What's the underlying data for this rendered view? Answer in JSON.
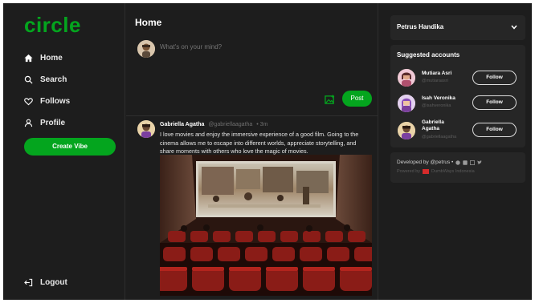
{
  "app": {
    "logo": "circle"
  },
  "sidebar": {
    "items": [
      {
        "label": "Home",
        "icon": "home-icon"
      },
      {
        "label": "Search",
        "icon": "search-icon"
      },
      {
        "label": "Follows",
        "icon": "heart-icon"
      },
      {
        "label": "Profile",
        "icon": "user-icon"
      }
    ],
    "create_label": "Create Vibe",
    "logout_label": "Logout"
  },
  "main": {
    "title": "Home",
    "compose": {
      "placeholder": "What's on your mind?",
      "post_label": "Post"
    },
    "post": {
      "author": "Gabriella Agatha",
      "handle": "@gabriellaagatha",
      "time": "• 3m",
      "text": "I love movies and enjoy the immersive experience of a good film. Going to the cinema allows me to escape into different worlds, appreciate storytelling, and share moments with others who love the magic of movies."
    }
  },
  "right": {
    "profile_name": "Petrus Handika",
    "suggested_title": "Suggested accounts",
    "accounts": [
      {
        "name": "Mutiara Asri",
        "handle": "@mutiaraasri",
        "button": "Follow"
      },
      {
        "name": "Isah Veronika",
        "handle": "@isahveronika",
        "button": "Follow"
      },
      {
        "name": "Gabriella Agatha",
        "handle": "@gabriellaagatha",
        "button": "Follow"
      }
    ],
    "developed_by": "Developed by @petrus •",
    "powered_by": "Powered by",
    "powered_name": "DumbWays Indonesia"
  },
  "colors": {
    "accent": "#04a51e",
    "background": "#1d1d1d",
    "card": "#262626"
  }
}
